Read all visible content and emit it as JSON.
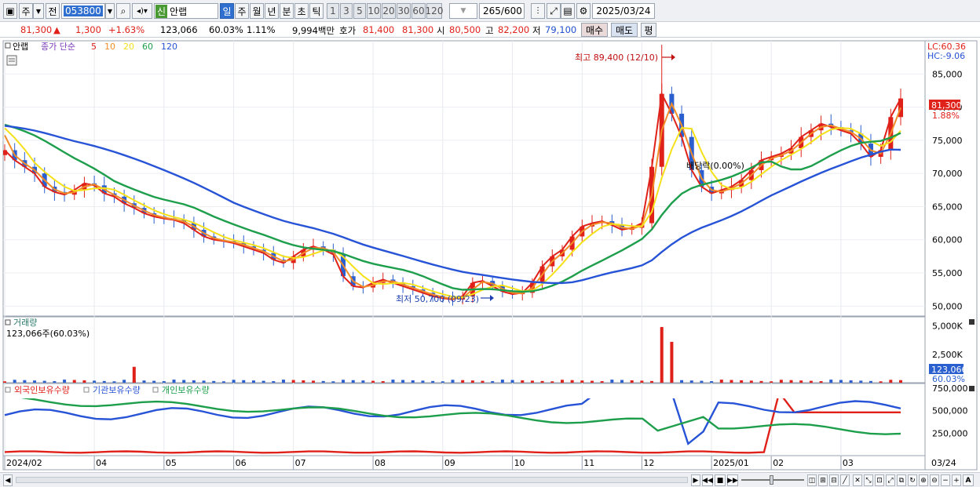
{
  "toolbar": {
    "period_mode": "주",
    "prev_label": "전",
    "stock_code": "053800",
    "new_badge": "신",
    "stock_name": "안랩",
    "periods": [
      "일",
      "주",
      "월",
      "년",
      "분",
      "초",
      "틱"
    ],
    "active_period": "일",
    "intervals": [
      "1",
      "3",
      "5",
      "10",
      "20",
      "30",
      "60",
      "120"
    ],
    "count_display": "265",
    "count_total": "/600",
    "date": "2025/03/24"
  },
  "quote": {
    "price": "81,300",
    "change_arrow": "▲",
    "change": "1,300",
    "change_pct": "+1.63%",
    "volume": "123,066",
    "volume_ratio": "60.03%",
    "turnover_pct": "1.11%",
    "amount": "9,994백만",
    "bid_label": "호가",
    "ask_price": "81,400",
    "bid_price": "81,300",
    "open_label": "시",
    "open": "80,500",
    "high_label": "고",
    "high": "82,200",
    "low_label": "저",
    "low": "79,100",
    "buy_label": "매수",
    "sell_label": "매도",
    "eval_label": "평"
  },
  "price_panel": {
    "title": "안랩",
    "ma_title": "종가 단순",
    "ma_periods": [
      "5",
      "10",
      "20",
      "60",
      "120"
    ],
    "ma_colors": [
      "#e0211a",
      "#f28c28",
      "#f5e11a",
      "#1d9e4b",
      "#2753d6"
    ],
    "lc_label": "LC:60.36",
    "hc_label": "HC:-9.06",
    "last_price_badge": "81,300",
    "last_pct": "1.88%",
    "high_annotation": "최고 89,400 (12/10)",
    "low_annotation": "최저 50,700 (09/23)",
    "dividend_annotation": "배당락(0.00%)"
  },
  "volume_panel": {
    "title": "거래량",
    "subtitle": "123,066주(60.03%)",
    "last_badge": "123,066",
    "last_pct": "60.03%"
  },
  "holdings_panel": {
    "legend": [
      "외국인보유수량",
      "기관보유수량",
      "개인보유수량"
    ]
  },
  "statusbar": {
    "last_date": "03/24"
  },
  "chart_data": [
    {
      "type": "candlestick",
      "title": "안랩",
      "x_dates_start": "2024-02",
      "x_month_labels": [
        "2024/02",
        "04",
        "05",
        "06",
        "07",
        "08",
        "09",
        "10",
        "11",
        "12",
        "2025/01",
        "02",
        "03"
      ],
      "y_ticks": [
        "85,000",
        "80,000",
        "75,000",
        "70,000",
        "65,000",
        "60,000",
        "55,000",
        "50,000"
      ],
      "ylim": [
        48500,
        90000
      ],
      "close_approx": [
        73500,
        72000,
        71000,
        70000,
        68000,
        67200,
        66800,
        67500,
        68500,
        68200,
        67000,
        66500,
        65500,
        64800,
        64000,
        63500,
        63200,
        63000,
        62500,
        61500,
        60500,
        60000,
        59800,
        59500,
        59000,
        58500,
        58000,
        57000,
        56500,
        57500,
        58500,
        59000,
        58500,
        57800,
        54500,
        53000,
        52800,
        53500,
        54000,
        53500,
        53000,
        52500,
        52000,
        51500,
        51200,
        51000,
        51500,
        53500,
        53800,
        53000,
        52200,
        51800,
        52000,
        53500,
        56000,
        57500,
        58500,
        60500,
        62000,
        62500,
        62800,
        62200,
        61500,
        61800,
        62500,
        71000,
        82000,
        79000,
        75500,
        70500,
        68000,
        67000,
        67500,
        68000,
        69000,
        70500,
        72000,
        72500,
        73000,
        73800,
        75500,
        76500,
        77500,
        77000,
        76500,
        76000,
        74500,
        72500,
        73500,
        78500,
        81300
      ],
      "series": [
        {
          "name": "5"
        },
        {
          "name": "10"
        },
        {
          "name": "20"
        },
        {
          "name": "60"
        },
        {
          "name": "120"
        }
      ],
      "annotations": [
        {
          "text": "최고 89,400 (12/10)",
          "value": 89400,
          "date": "12/10"
        },
        {
          "text": "최저 50,700 (09/23)",
          "value": 50700,
          "date": "09/23"
        },
        {
          "text": "배당락(0.00%)"
        }
      ],
      "last_price": 81300
    },
    {
      "type": "bar",
      "title": "거래량",
      "y_ticks": [
        "5,000K",
        "2,500K"
      ],
      "ylim": [
        0,
        5800000
      ],
      "peaks": [
        {
          "date": "04",
          "value": 1400000
        },
        {
          "date": "12/10",
          "value": 4900000
        },
        {
          "date": "12/11",
          "value": 3600000
        }
      ],
      "last_value": 123066
    },
    {
      "type": "line",
      "series": [
        {
          "name": "외국인보유수량",
          "color": "#e0211a"
        },
        {
          "name": "기관보유수량",
          "color": "#2753d6"
        },
        {
          "name": "개인보유수량",
          "color": "#1d9e4b"
        }
      ],
      "y_ticks": [
        "750,000",
        "500,000",
        "250,000"
      ],
      "ylim": [
        0,
        800000
      ]
    }
  ]
}
